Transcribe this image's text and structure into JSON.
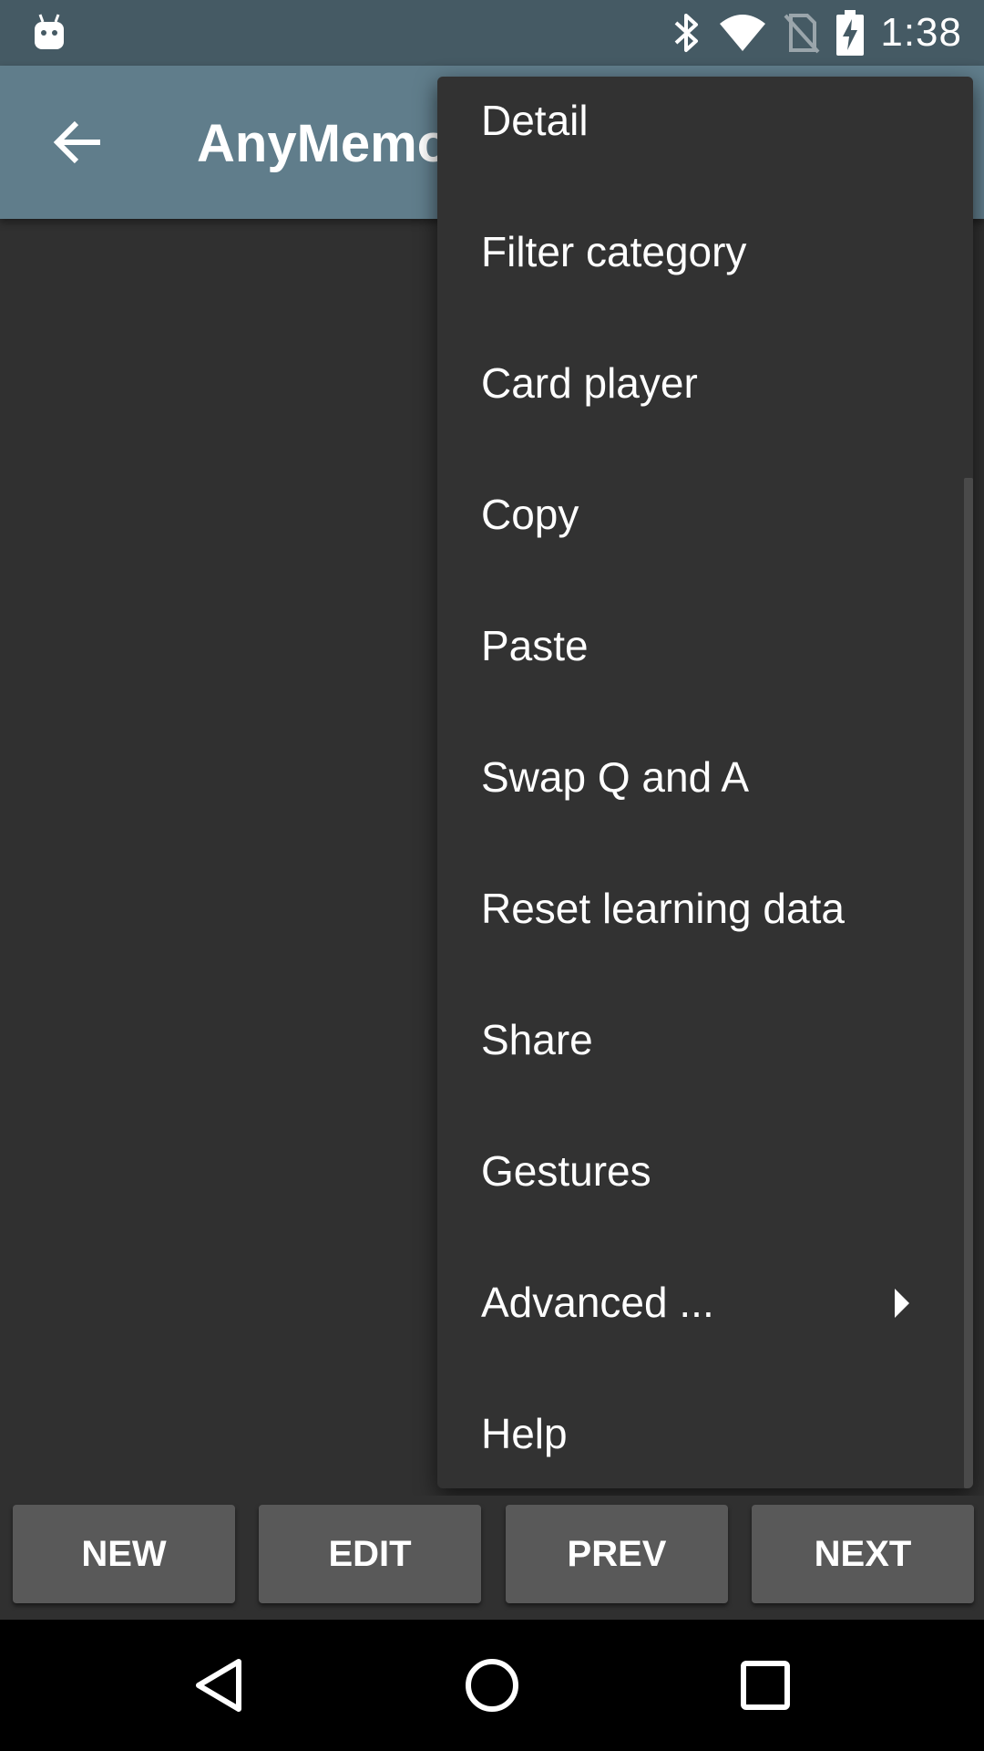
{
  "status_bar": {
    "time": "1:38",
    "icons": [
      "android-icon",
      "bluetooth-icon",
      "wifi-icon",
      "no-sim-icon",
      "battery-charging-icon"
    ]
  },
  "app_bar": {
    "title": "AnyMemo",
    "back_icon": "arrow-back-icon"
  },
  "menu": {
    "items": [
      {
        "label": "Detail"
      },
      {
        "label": "Filter category"
      },
      {
        "label": "Card player"
      },
      {
        "label": "Copy"
      },
      {
        "label": "Paste"
      },
      {
        "label": "Swap Q and A"
      },
      {
        "label": "Reset learning data"
      },
      {
        "label": "Share"
      },
      {
        "label": "Gestures"
      },
      {
        "label": "Advanced ...",
        "has_submenu": true
      },
      {
        "label": "Help"
      }
    ]
  },
  "buttons": {
    "new_label": "NEW",
    "edit_label": "EDIT",
    "prev_label": "PREV",
    "next_label": "NEXT"
  },
  "nav_bar": {
    "icons": [
      "back-triangle-icon",
      "home-circle-icon",
      "recents-square-icon"
    ]
  },
  "colors": {
    "status_bar": "#455a64",
    "app_bar": "#607d8b",
    "menu_background": "#323232",
    "screen_background": "#303030",
    "button_background": "#595959"
  }
}
